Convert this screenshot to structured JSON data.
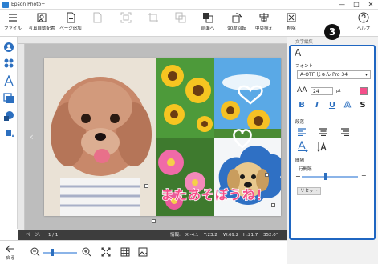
{
  "window": {
    "title": "Epson Photo+",
    "controls": [
      "—",
      "□",
      "✕"
    ]
  },
  "toolbar": {
    "items": [
      {
        "label": "ファイル",
        "icon": "hamburger-menu-icon"
      },
      {
        "label": "写真自動配置",
        "icon": "auto-layout-icon"
      },
      {
        "label": "ページ追加",
        "icon": "add-page-icon"
      },
      {
        "label": "",
        "icon": "layout-icon"
      },
      {
        "label": "",
        "icon": "fit-frame-icon"
      },
      {
        "label": "",
        "icon": "crop-icon"
      },
      {
        "label": "",
        "icon": "copy-icon"
      },
      {
        "label": "前面へ",
        "icon": "bring-front-icon"
      },
      {
        "label": "90度回転",
        "icon": "rotate-icon"
      },
      {
        "label": "中央揃え",
        "icon": "center-align-icon"
      },
      {
        "label": "削除",
        "icon": "delete-icon"
      },
      {
        "label": "ヘルプ",
        "icon": "help-icon"
      }
    ]
  },
  "left_tools": [
    "person-icon",
    "stamp-icon",
    "text-icon",
    "frame-icon",
    "background-icon",
    "fill-icon"
  ],
  "canvas": {
    "overlay_text": "またあそぼうね！"
  },
  "statusbar": {
    "page_label": "ページ:",
    "page_value": "1 / 1",
    "info_label": "情報:",
    "x": "X:-4.1",
    "y": "Y:23.2",
    "w": "W:69.2",
    "h": "H:21.7",
    "angle": "352.0°"
  },
  "bottombar": {
    "back_label": "戻る"
  },
  "panel": {
    "header": "文字編集",
    "big_glyph": "A",
    "font_label": "フォント",
    "font_value": "A-OTF じゅん Pro 34",
    "size_glyph": "AA",
    "size_value": "24",
    "size_unit": "pt",
    "styles": [
      "B",
      "I",
      "U",
      "A",
      "S"
    ],
    "paragraph_label": "段落",
    "spacing_label": "間隔",
    "line_spacing_label": "行間隔",
    "minus": "−",
    "plus": "+",
    "reset_label": "リセット",
    "text_color": "#f44f8a"
  },
  "callout": {
    "number": "3"
  }
}
